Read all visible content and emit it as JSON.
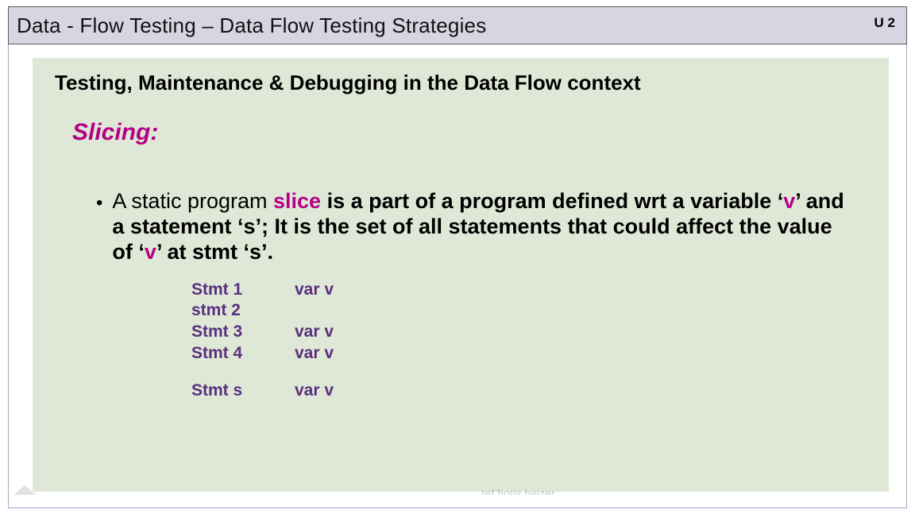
{
  "header": {
    "title": "Data - Flow Testing   – Data Flow Testing Strategies",
    "unit": "U 2"
  },
  "content": {
    "subtitle": "Testing, Maintenance & Debugging in the Data Flow context",
    "slicing_label": "Slicing:",
    "bullet": {
      "pre": "A static program ",
      "slice": "slice",
      "mid1": " is a part of a program defined wrt a variable ‘",
      "v1": "v",
      "mid2": "’ and a statement ‘s’; It is the set of all statements that could affect the value of ‘",
      "v2": "v",
      "mid3": "’ at stmt ‘s’."
    },
    "table": {
      "rows": [
        {
          "stmt": "Stmt 1",
          "var": "var v"
        },
        {
          "stmt": "stmt 2",
          "var": ""
        },
        {
          "stmt": "Stmt 3",
          "var": "var v"
        },
        {
          "stmt": "Stmt 4",
          "var": "var v"
        }
      ],
      "last": {
        "stmt": "Stmt s",
        "var": "var  v"
      }
    }
  },
  "footer": "ref boris beizer"
}
